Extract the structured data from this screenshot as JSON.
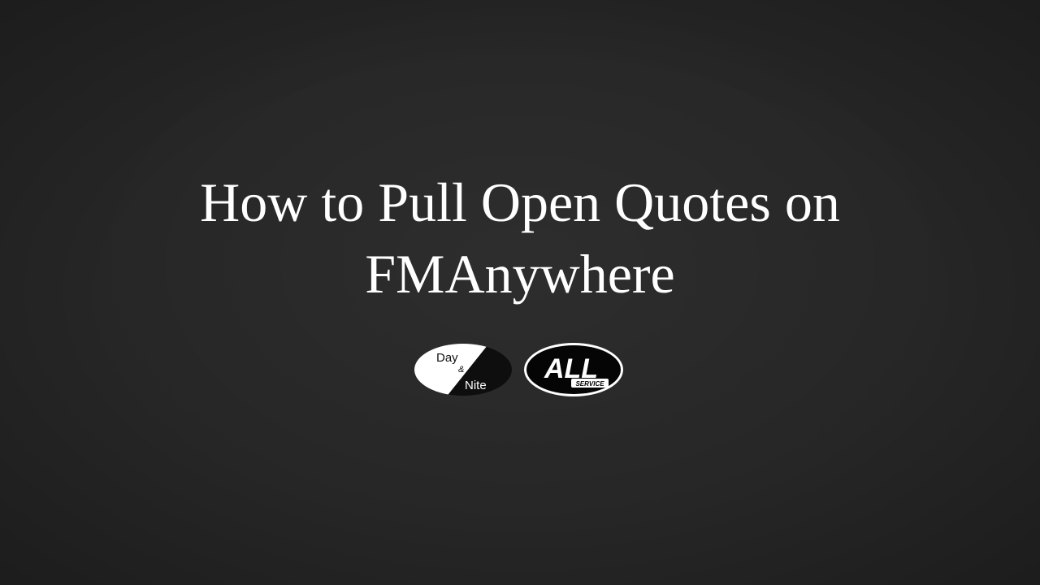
{
  "slide": {
    "title_line1": "How to Pull Open Quotes on",
    "title_line2": "FMAnywhere"
  },
  "logos": {
    "daynite": {
      "word1": "Day",
      "amp": "&",
      "word2": "Nite",
      "icon": "day-and-nite-logo-icon"
    },
    "allservice": {
      "main": "ALL",
      "sub": "SERVICE",
      "icon": "all-service-logo-icon"
    }
  },
  "colors": {
    "background": "#262626",
    "title": "#ffffff",
    "logo_white": "#ffffff",
    "logo_black": "#000000"
  }
}
